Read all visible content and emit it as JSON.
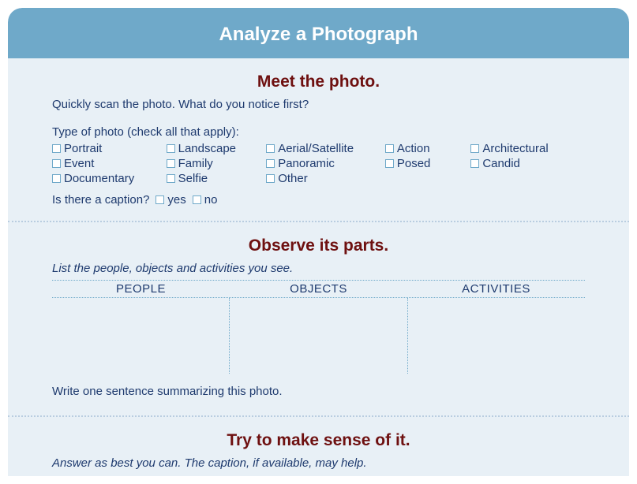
{
  "title": "Analyze a Photograph",
  "sections": {
    "meet": {
      "heading": "Meet the photo.",
      "prompt1": "Quickly scan the photo. What do you notice first?",
      "typeLabel": "Type of photo (check all that apply):",
      "types": {
        "portrait": "Portrait",
        "landscape": "Landscape",
        "aerial": "Aerial/Satellite",
        "action": "Action",
        "architectural": "Architectural",
        "event": "Event",
        "family": "Family",
        "panoramic": "Panoramic",
        "posed": "Posed",
        "candid": "Candid",
        "documentary": "Documentary",
        "selfie": "Selfie",
        "other": "Other"
      },
      "captionQuestion": "Is there a caption?",
      "yes": "yes",
      "no": "no"
    },
    "observe": {
      "heading": "Observe its parts.",
      "prompt1": "List the people, objects and activities you see.",
      "col1": "PEOPLE",
      "col2": "OBJECTS",
      "col3": "ACTIVITIES",
      "prompt2": "Write one sentence summarizing this photo."
    },
    "sense": {
      "heading": "Try to make sense of it.",
      "prompt1": "Answer as best you can. The caption, if available, may help."
    }
  }
}
